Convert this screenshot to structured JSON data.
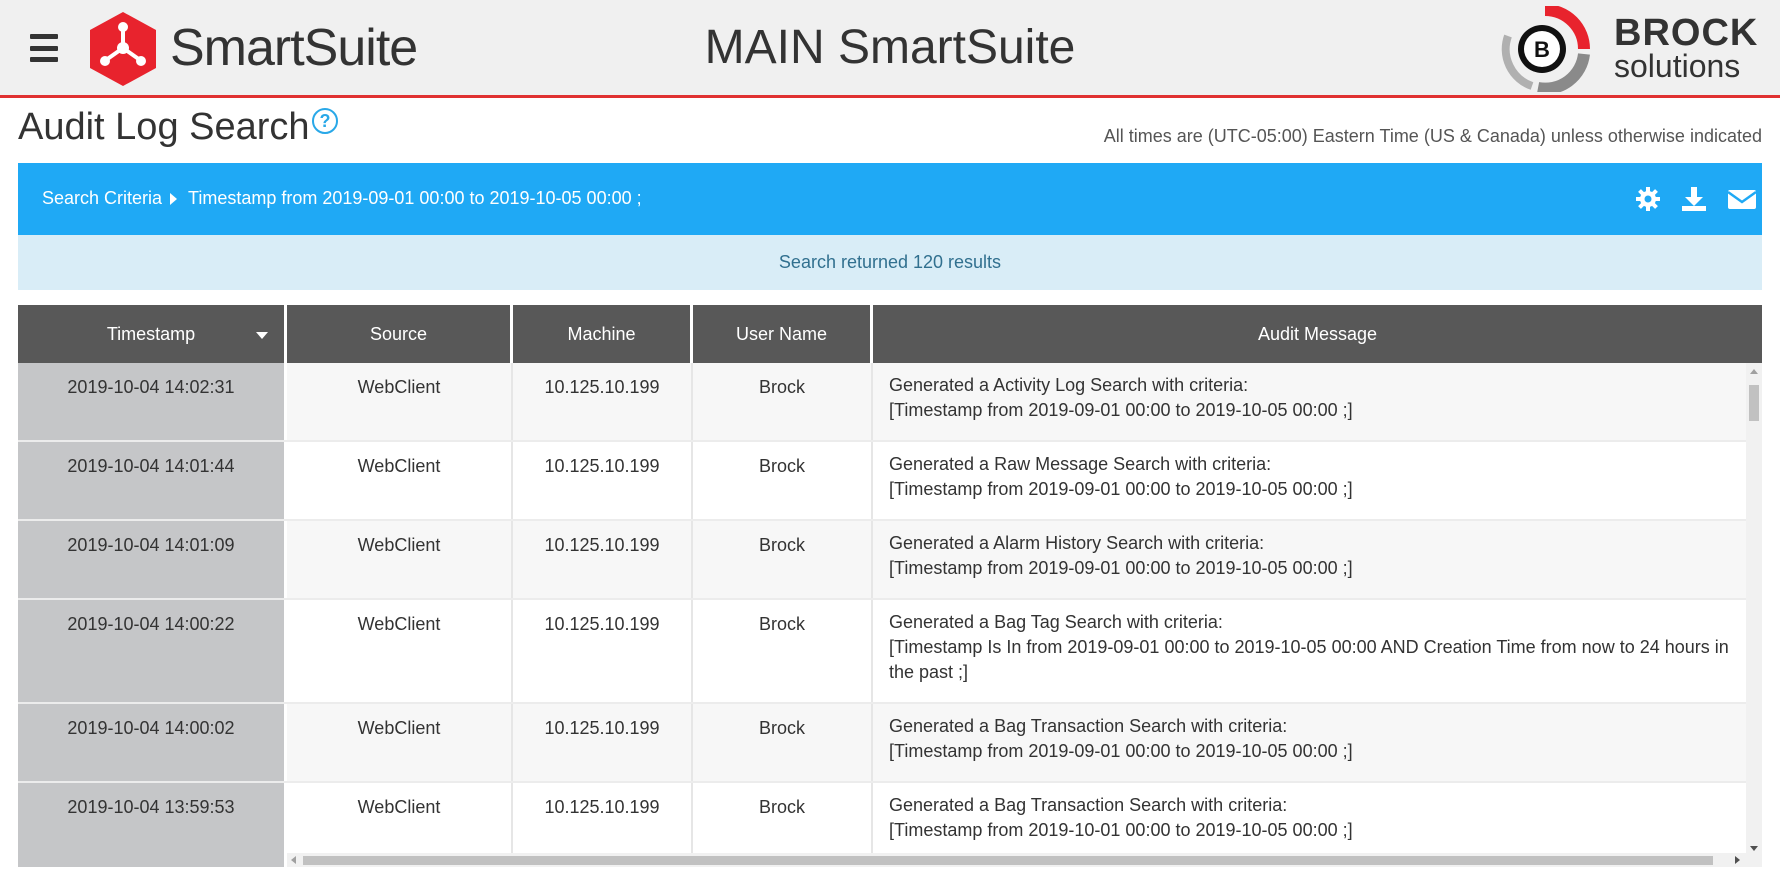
{
  "header": {
    "brand_name": "SmartSuite",
    "main_title": "MAIN SmartSuite",
    "brock_line1": "BROCK",
    "brock_line2": "solutions",
    "brock_badge": "B"
  },
  "page": {
    "title": "Audit Log Search",
    "help_symbol": "?",
    "timezone_note": "All times are (UTC-05:00) Eastern Time (US & Canada) unless otherwise indicated"
  },
  "criteria": {
    "label": "Search Criteria",
    "text": "Timestamp from 2019-09-01 00:00 to 2019-10-05 00:00 ;",
    "icons": [
      "gear-icon",
      "download-icon",
      "envelope-icon"
    ]
  },
  "results": {
    "text": "Search returned 120 results"
  },
  "table": {
    "columns": [
      "Timestamp",
      "Source",
      "Machine",
      "User Name",
      "Audit Message"
    ],
    "rows": [
      {
        "timestamp": "2019-10-04 14:02:31",
        "source": "WebClient",
        "machine": "10.125.10.199",
        "user": "Brock",
        "message_line1": "Generated a Activity Log Search with criteria:",
        "message_line2": "[Timestamp from 2019-09-01 00:00 to 2019-10-05 00:00 ;]"
      },
      {
        "timestamp": "2019-10-04 14:01:44",
        "source": "WebClient",
        "machine": "10.125.10.199",
        "user": "Brock",
        "message_line1": "Generated a Raw Message Search with criteria:",
        "message_line2": "[Timestamp from 2019-09-01 00:00 to 2019-10-05 00:00 ;]"
      },
      {
        "timestamp": "2019-10-04 14:01:09",
        "source": "WebClient",
        "machine": "10.125.10.199",
        "user": "Brock",
        "message_line1": "Generated a Alarm History Search with criteria:",
        "message_line2": "[Timestamp from 2019-09-01 00:00 to 2019-10-05 00:00 ;]"
      },
      {
        "timestamp": "2019-10-04 14:00:22",
        "source": "WebClient",
        "machine": "10.125.10.199",
        "user": "Brock",
        "message_line1": "Generated a Bag Tag Search with criteria:",
        "message_line2": "[Timestamp Is In from 2019-09-01 00:00 to 2019-10-05 00:00 AND Creation Time from now to 24 hours in the past ;]"
      },
      {
        "timestamp": "2019-10-04 14:00:02",
        "source": "WebClient",
        "machine": "10.125.10.199",
        "user": "Brock",
        "message_line1": "Generated a Bag Transaction Search with criteria:",
        "message_line2": "[Timestamp from 2019-09-01 00:00 to 2019-10-05 00:00 ;]"
      },
      {
        "timestamp": "2019-10-04 13:59:53",
        "source": "WebClient",
        "machine": "10.125.10.199",
        "user": "Brock",
        "message_line1": "Generated a Bag Transaction Search with criteria:",
        "message_line2": "[Timestamp from 2019-10-01 00:00 to 2019-10-05 00:00 ;]"
      }
    ]
  },
  "colors": {
    "accent_red": "#e03131",
    "criteria_blue": "#1fa9f5",
    "banner_bg": "#d9edf7",
    "header_gray": "#585858"
  }
}
